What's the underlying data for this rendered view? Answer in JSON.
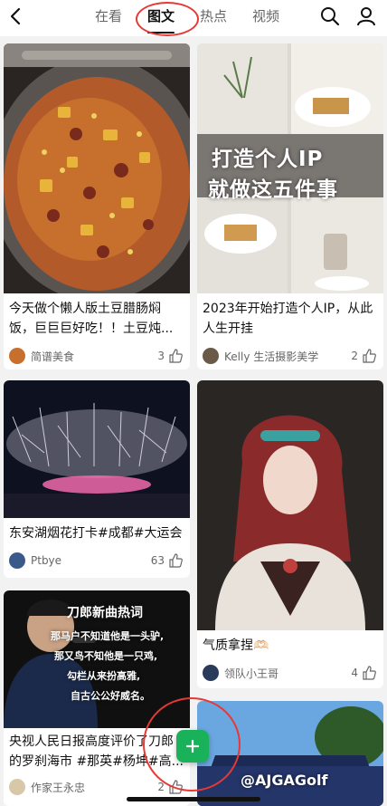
{
  "header": {
    "tabs": [
      "在看",
      "图文",
      "热点",
      "视频"
    ],
    "active_tab": "图文",
    "icons": [
      "back-chevron-icon",
      "search-icon",
      "user-icon"
    ]
  },
  "feed": [
    {
      "title": "今天做个懒人版土豆腊肠焖饭，巨巨巨好吃！！土豆炖...",
      "author": "简谱美食",
      "likes": "3"
    },
    {
      "title": "2023年开始打造个人IP，从此人生开挂",
      "overlay_text": [
        "打造个人IP",
        "就做这五件事"
      ],
      "author": "Kelly 生活摄影美学",
      "likes": "2"
    },
    {
      "title": "东安湖烟花打卡#成都#大运会",
      "author": "Ptbye",
      "likes": "63"
    },
    {
      "title": "气质拿捏🫶🏻",
      "author": "领队小王哥",
      "likes": "4"
    },
    {
      "title": "央视人民日报高度评价了刀郎的罗刹海市 #那英#杨坤#高...",
      "overlay_title": "刀郎新曲热词",
      "overlay_lines": [
        "那马户不知道他是一头驴,",
        "那又鸟不知他是一只鸡,",
        "勾栏从来扮高雅,",
        "自古公公好威名。"
      ],
      "author": "作家王永忠",
      "likes": "2"
    },
    {
      "overlay_text": [
        "@AJGAGolf"
      ]
    }
  ],
  "fab": {
    "label": "+"
  },
  "colors": {
    "accent_green": "#19b25a",
    "annotation_red": "#e53935"
  }
}
